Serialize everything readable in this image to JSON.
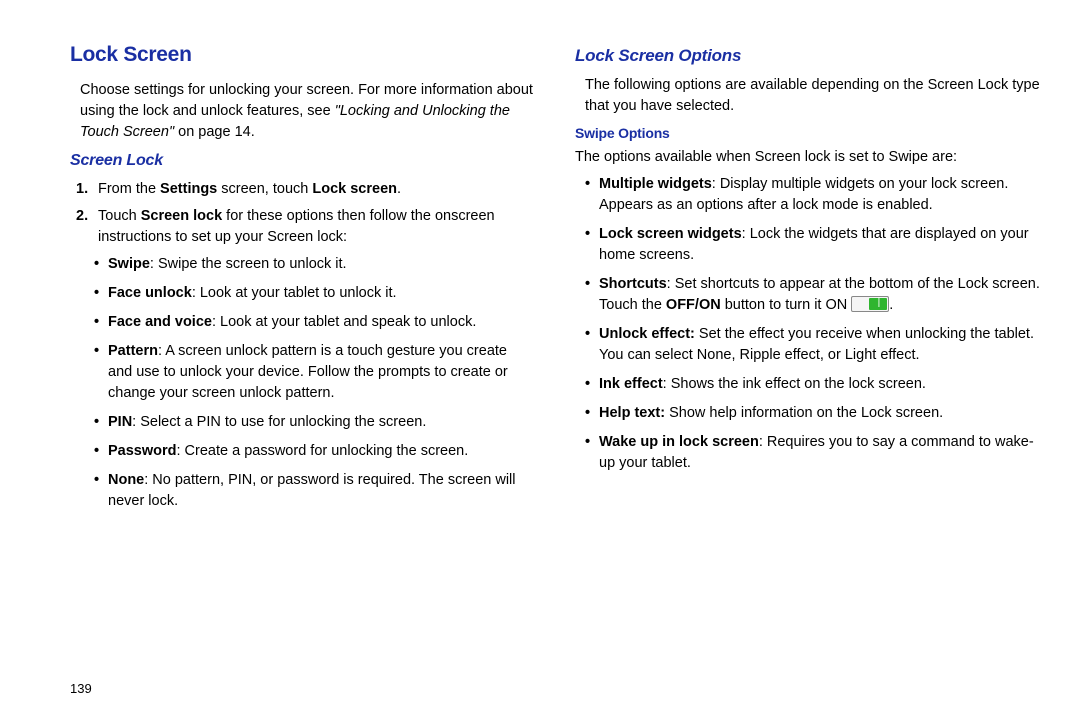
{
  "left": {
    "title": "Lock Screen",
    "intro_a": "Choose settings for unlocking your screen. For more information about using the lock and unlock features, see ",
    "intro_ref": "\"Locking and Unlocking the Touch Screen\"",
    "intro_b": " on page 14.",
    "sub": "Screen Lock",
    "step1_a": "From the ",
    "step1_b": "Settings",
    "step1_c": " screen, touch ",
    "step1_d": "Lock screen",
    "step1_e": ".",
    "step2_a": "Touch ",
    "step2_b": "Screen lock",
    "step2_c": " for these options then follow the onscreen instructions to set up your Screen lock:",
    "swipe_b": "Swipe",
    "swipe_t": ": Swipe the screen to unlock it.",
    "face_b": "Face unlock",
    "face_t": ": Look at your tablet to unlock it.",
    "fv_b": "Face and voice",
    "fv_t": ": Look at your tablet and speak to unlock.",
    "pattern_b": "Pattern",
    "pattern_t": ": A screen unlock pattern is a touch gesture you create and use to unlock your device. Follow the prompts to create or change your screen unlock pattern.",
    "pin_b": "PIN",
    "pin_t": ": Select a PIN to use for unlocking the screen.",
    "pw_b": "Password",
    "pw_t": ": Create a password for unlocking the screen.",
    "none_b": "None",
    "none_t": ": No pattern, PIN, or password is required. The screen will never lock."
  },
  "right": {
    "title": "Lock Screen Options",
    "intro": "The following options are available depending on the Screen Lock type that you have selected.",
    "sub": "Swipe Options",
    "lead": "The options available when Screen lock is set to Swipe are:",
    "mw_b": "Multiple widgets",
    "mw_t": ": Display multiple widgets on your lock screen. Appears as an options after a lock mode is enabled.",
    "lsw_b": "Lock screen widgets",
    "lsw_t": ": Lock the widgets that are displayed on your home screens.",
    "sc_b": "Shortcuts",
    "sc_t1": ": Set shortcuts to appear at the bottom of the Lock screen. Touch the ",
    "sc_t2": "OFF/ON",
    "sc_t3": " button to turn it ON ",
    "sc_t4": ".",
    "ue_b": "Unlock effect:",
    "ue_t": " Set the effect you receive when unlocking the tablet. You can select None, Ripple effect, or Light effect.",
    "ink_b": "Ink effect",
    "ink_t": ": Shows the ink effect on the lock screen.",
    "ht_b": "Help text:",
    "ht_t": " Show help information on the Lock screen.",
    "wu_b": "Wake up in lock screen",
    "wu_t": ": Requires you to say a command to wake-up your tablet."
  },
  "pagenum": "139"
}
